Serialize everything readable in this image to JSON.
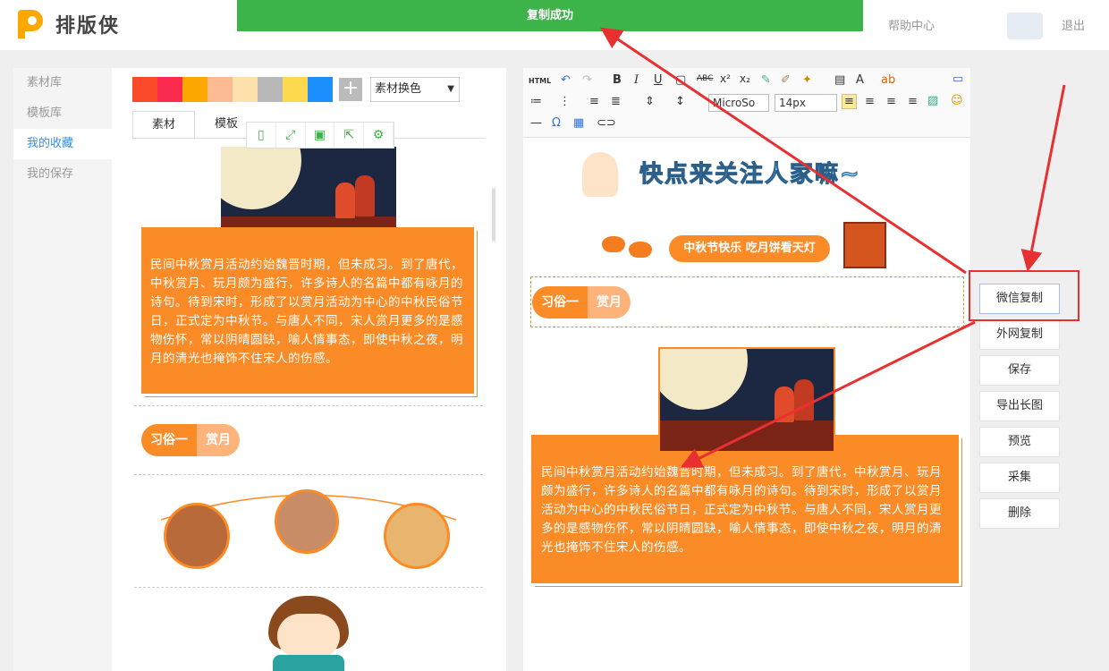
{
  "app": {
    "name": "排版侠"
  },
  "toast": {
    "text": "复制成功"
  },
  "header": {
    "help": "帮助中心",
    "logout": "退出"
  },
  "sidenav": {
    "items": [
      "素材库",
      "模板库",
      "我的收藏",
      "我的保存"
    ],
    "active": 2
  },
  "material": {
    "swatches": [
      "#fb4a2a",
      "#fd2a4f",
      "#fda800",
      "#fdbb94",
      "#fde0ab",
      "#b8b8b8",
      "#fdd94f",
      "#1a8ffd"
    ],
    "plus": "+",
    "color_swap": "素材换色",
    "tabs": [
      "素材",
      "模板"
    ],
    "card_text": "民间中秋赏月活动约始魏晋时期，但未成习。到了唐代，中秋赏月、玩月颇为盛行，许多诗人的名篇中都有咏月的诗句。待到宋时，形成了以赏月活动为中心的中秋民俗节日，正式定为中秋节。与唐人不同，宋人赏月更多的是感物伤怀，常以阴晴圆缺，喻人情事态，即使中秋之夜，明月的清光也掩饰不住宋人的伤感。",
    "tag_left": "习俗一",
    "tag_right": "赏月"
  },
  "editor": {
    "toolbar": {
      "html": "HTML",
      "font": "MicroSo",
      "size": "14px"
    },
    "heading": "快点来关注人家嘛~",
    "banner": "中秋节快乐 吃月饼看天灯",
    "tag_left": "习俗一",
    "tag_right": "赏月",
    "card_text": "民间中秋赏月活动约始魏晋时期，但未成习。到了唐代，中秋赏月、玩月颇为盛行，许多诗人的名篇中都有咏月的诗句。待到宋时，形成了以赏月活动为中心的中秋民俗节日，正式定为中秋节。与唐人不同，宋人赏月更多的是感物伤怀，常以阴晴圆缺，喻人情事态，即使中秋之夜，明月的清光也掩饰不住宋人的伤感。"
  },
  "actions": [
    "微信复制",
    "外网复制",
    "保存",
    "导出长图",
    "预览",
    "采集",
    "删除"
  ]
}
